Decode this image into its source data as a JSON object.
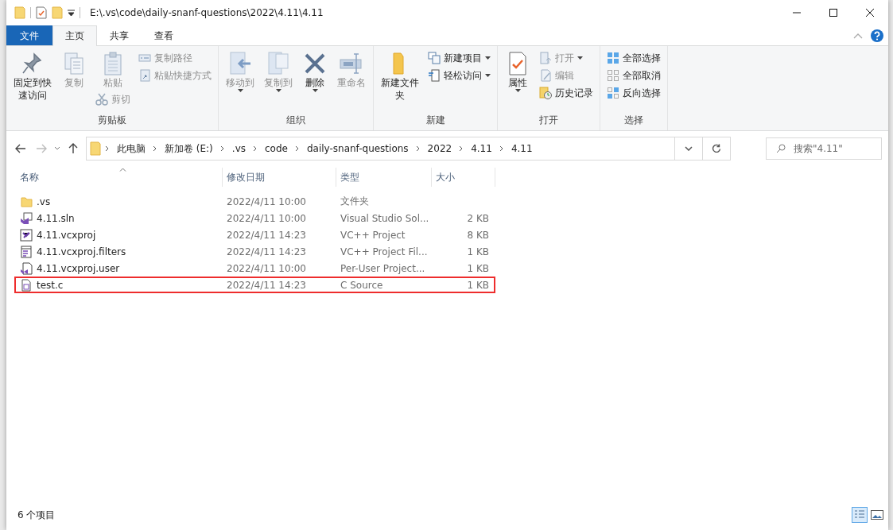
{
  "title_bar": {
    "path": "E:\\.vs\\code\\daily-snanf-questions\\2022\\4.11\\4.11"
  },
  "ribbon_tabs": [
    {
      "label": "文件",
      "kind": "file_menu",
      "selected": false
    },
    {
      "label": "主页",
      "kind": "tab",
      "selected": true
    },
    {
      "label": "共享",
      "kind": "tab",
      "selected": false
    },
    {
      "label": "查看",
      "kind": "tab",
      "selected": false
    }
  ],
  "ribbon_groups": [
    {
      "label": "剪贴板",
      "columns": [
        [
          {
            "label": "固定到快速访问",
            "kind": "large",
            "disabled": false
          }
        ],
        [
          {
            "label": "复制",
            "kind": "large",
            "disabled": true
          }
        ],
        [
          {
            "label": "粘贴",
            "kind": "large",
            "disabled": true
          },
          {
            "label": "剪切",
            "kind": "small",
            "disabled": true
          }
        ],
        [
          {
            "label": "复制路径",
            "kind": "small",
            "disabled": true
          },
          {
            "label": "粘贴快捷方式",
            "kind": "small",
            "disabled": true
          }
        ]
      ]
    },
    {
      "label": "组织",
      "columns": [
        [
          {
            "label": "移动到",
            "kind": "large",
            "disabled": true,
            "dropdown": true
          }
        ],
        [
          {
            "label": "复制到",
            "kind": "large",
            "disabled": true,
            "dropdown": true
          }
        ],
        [
          {
            "label": "删除",
            "kind": "large",
            "disabled": false,
            "dropdown": true
          }
        ],
        [
          {
            "label": "重命名",
            "kind": "large",
            "disabled": true
          }
        ]
      ]
    },
    {
      "label": "新建",
      "columns": [
        [
          {
            "label": "新建文件夹",
            "kind": "large",
            "disabled": false
          }
        ],
        [
          {
            "label": "新建项目",
            "kind": "small",
            "disabled": false,
            "dropdown": true
          },
          {
            "label": "轻松访问",
            "kind": "small",
            "disabled": false,
            "dropdown": true
          }
        ]
      ]
    },
    {
      "label": "打开",
      "columns": [
        [
          {
            "label": "属性",
            "kind": "large",
            "disabled": false,
            "dropdown": true
          }
        ],
        [
          {
            "label": "打开",
            "kind": "small",
            "disabled": true,
            "dropdown": true
          },
          {
            "label": "编辑",
            "kind": "small",
            "disabled": true
          },
          {
            "label": "历史记录",
            "kind": "small",
            "disabled": false
          }
        ]
      ]
    },
    {
      "label": "选择",
      "columns": [
        [
          {
            "label": "全部选择",
            "kind": "small",
            "disabled": false
          },
          {
            "label": "全部取消",
            "kind": "small",
            "disabled": false
          },
          {
            "label": "反向选择",
            "kind": "small",
            "disabled": false
          }
        ]
      ]
    }
  ],
  "address": {
    "segments": [
      "此电脑",
      "新加卷 (E:)",
      ".vs",
      "code",
      "daily-snanf-questions",
      "2022",
      "4.11",
      "4.11"
    ]
  },
  "search": {
    "placeholder": "搜索\"4.11\""
  },
  "columns": [
    {
      "label": "名称",
      "sorted": true
    },
    {
      "label": "修改日期",
      "sorted": false
    },
    {
      "label": "类型",
      "sorted": false
    },
    {
      "label": "大小",
      "sorted": false
    }
  ],
  "files": [
    {
      "name": ".vs",
      "modified": "2022/4/11 10:00",
      "type": "文件夹",
      "kind": "folder",
      "highlighted": false
    },
    {
      "name": "4.11.sln",
      "modified": "2022/4/11 10:00",
      "type": "Visual Studio Sol...",
      "size": "2 KB",
      "kind": "solution",
      "highlighted": false
    },
    {
      "name": "4.11.vcxproj",
      "modified": "2022/4/11 14:23",
      "type": "VC++ Project",
      "size": "8 KB",
      "kind": "project",
      "highlighted": false
    },
    {
      "name": "4.11.vcxproj.filters",
      "modified": "2022/4/11 14:23",
      "type": "VC++ Project Fil...",
      "size": "1 KB",
      "kind": "filters",
      "highlighted": false
    },
    {
      "name": "4.11.vcxproj.user",
      "modified": "2022/4/11 10:00",
      "type": "Per-User Project...",
      "size": "1 KB",
      "kind": "user",
      "highlighted": false
    },
    {
      "name": "test.c",
      "modified": "2022/4/11 14:23",
      "type": "C Source",
      "size": "1 KB",
      "kind": "source",
      "highlighted": true
    }
  ],
  "status_bar": {
    "item_count": "6 个项目",
    "views": [
      {
        "kind": "details",
        "selected": true
      },
      {
        "kind": "large_icons",
        "selected": false
      }
    ]
  }
}
